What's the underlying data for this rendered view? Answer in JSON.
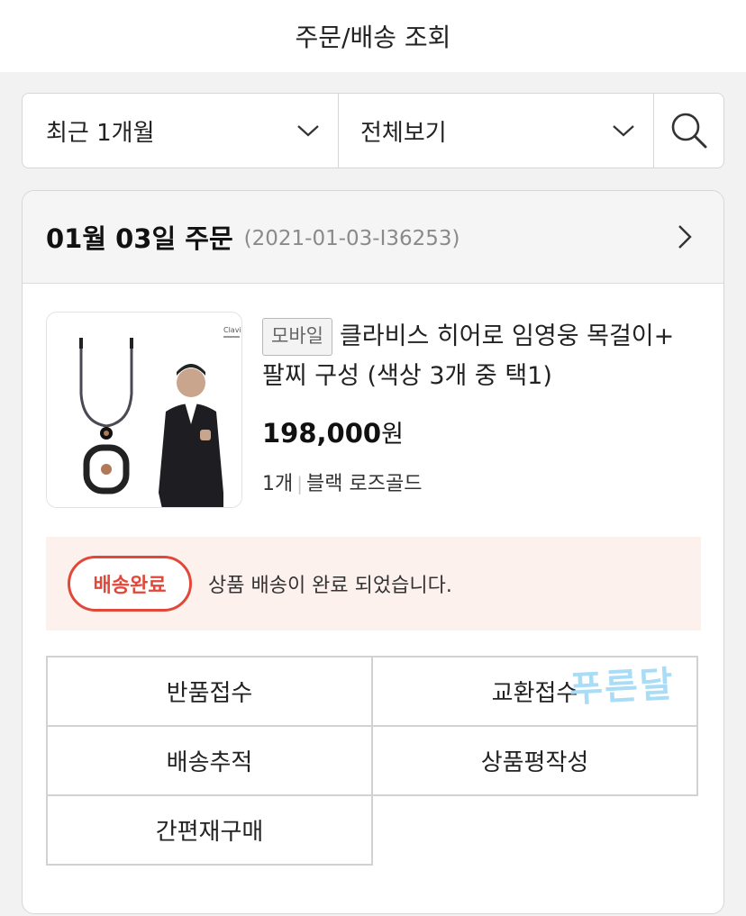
{
  "header": {
    "title": "주문/배송 조회"
  },
  "filters": {
    "period": "최근 1개월",
    "type": "전체보기"
  },
  "order": {
    "date": "01월 03일 주문",
    "order_id": "(2021-01-03-I36253)",
    "product": {
      "badge": "모바일",
      "name_line1": "클라비스 히어로 임영웅 목걸이+",
      "name_line2": "팔찌 구성 (색상 3개 중 택1)",
      "price": "198,000",
      "price_unit": "원",
      "quantity": "1개",
      "option": "블랙 로즈골드",
      "thumb_brand": "Clavis"
    },
    "status": {
      "label": "배송완료",
      "message": "상품 배송이 완료 되었습니다."
    },
    "actions": [
      "반품접수",
      "교환접수",
      "배송추적",
      "상품평작성",
      "간편재구매"
    ]
  },
  "watermark": "푸른달",
  "colors": {
    "status_red": "#e0483a",
    "status_bg": "#fdf1ee",
    "watermark": "#a9dcf7"
  },
  "icons": {
    "period_dropdown": "chevron-down-icon",
    "type_dropdown": "chevron-down-icon",
    "search": "search-icon",
    "order_detail": "chevron-right-icon"
  }
}
